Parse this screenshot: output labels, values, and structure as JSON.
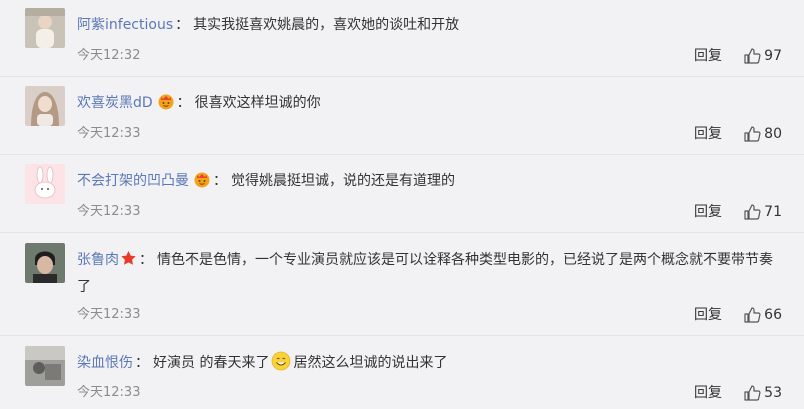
{
  "comments": [
    {
      "username": "阿紫infectious",
      "text": "其实我挺喜欢姚晨的，喜欢她的谈吐和开放",
      "time": "今天12:32",
      "reply": "回复",
      "likes": "97",
      "badge": null
    },
    {
      "username": "欢喜炭黑dD",
      "text": "很喜欢这样坦诚的你",
      "time": "今天12:33",
      "reply": "回复",
      "likes": "80",
      "badge": "crown-face-icon"
    },
    {
      "username": "不会打架的凹凸曼",
      "text": "觉得姚晨挺坦诚，说的还是有道理的",
      "time": "今天12:33",
      "reply": "回复",
      "likes": "71",
      "badge": "crown-face-icon"
    },
    {
      "username": "张鲁肉",
      "text": "情色不是色情，一个专业演员就应该是可以诠释各种类型电影的，已经说了是两个概念就不要带节奏了",
      "time": "今天12:33",
      "reply": "回复",
      "likes": "66",
      "badge": "red-star-icon"
    },
    {
      "username": "染血恨伤",
      "text_a": "好演员 的春天来了",
      "text_b": "居然这么坦诚的说出来了",
      "time": "今天12:33",
      "reply": "回复",
      "likes": "53",
      "badge": null
    }
  ],
  "colors": {
    "username": "#5b78b5",
    "background": "#f2f2f5",
    "text": "#333333",
    "meta": "#8c8c8c"
  }
}
